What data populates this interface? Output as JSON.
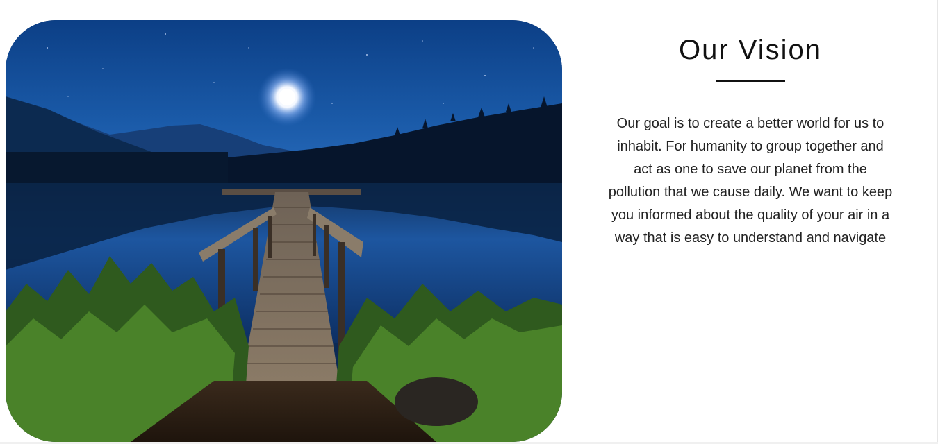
{
  "vision": {
    "title": "Our Vision",
    "body": "Our goal is to create a better world for us to inhabit. For humanity to group together and act as one to save our planet from the pollution that we cause daily. We want to keep you informed about the quality of your air in a way that is easy to understand and navigate"
  },
  "photo": {
    "subject": "night-lake-dock-photo"
  }
}
